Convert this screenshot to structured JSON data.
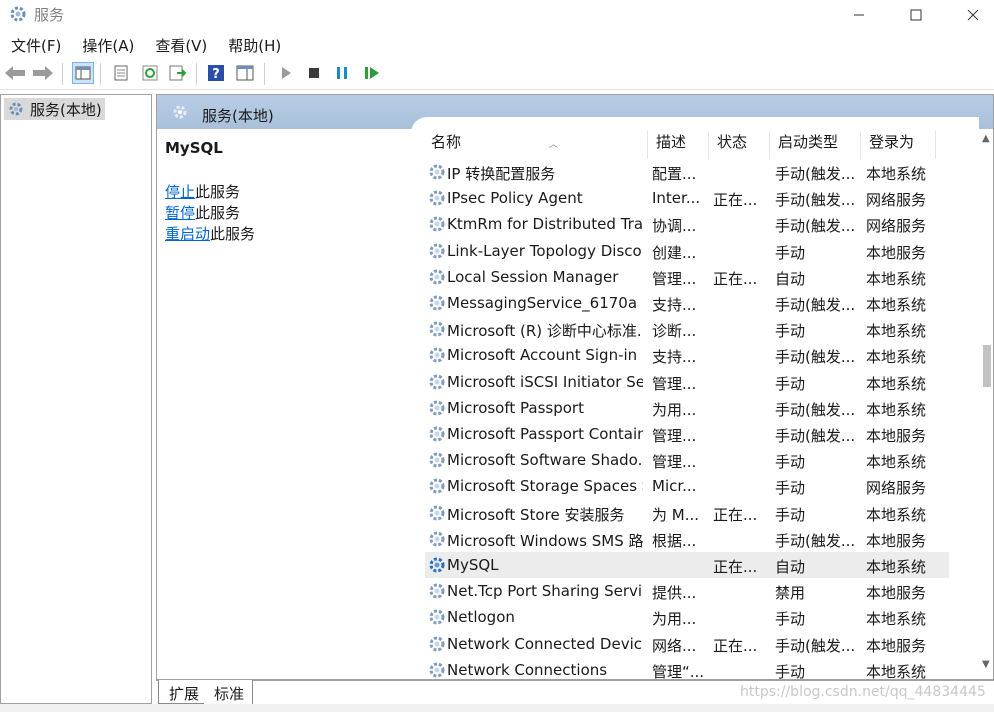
{
  "window": {
    "title": "服务",
    "icon": "gear-icon"
  },
  "menu": [
    "文件(F)",
    "操作(A)",
    "查看(V)",
    "帮助(H)"
  ],
  "tree": {
    "root_label": "服务(本地)"
  },
  "header": {
    "title": "服务(本地)"
  },
  "detail": {
    "service_name": "MySQL",
    "actions": [
      {
        "link": "停止",
        "suffix": "此服务"
      },
      {
        "link": "暂停",
        "suffix": "此服务"
      },
      {
        "link": "重启动",
        "suffix": "此服务"
      }
    ]
  },
  "columns": {
    "name": "名称",
    "desc": "描述",
    "status": "状态",
    "startup": "启动类型",
    "logon": "登录为"
  },
  "rows": [
    {
      "name": "IP 转换配置服务",
      "desc": "配置...",
      "status": "",
      "startup": "手动(触发...",
      "logon": "本地系统"
    },
    {
      "name": "IPsec Policy Agent",
      "desc": "Inter...",
      "status": "正在...",
      "startup": "手动(触发...",
      "logon": "网络服务"
    },
    {
      "name": "KtmRm for Distributed Tra...",
      "desc": "协调...",
      "status": "",
      "startup": "手动(触发...",
      "logon": "网络服务"
    },
    {
      "name": "Link-Layer Topology Disco...",
      "desc": "创建...",
      "status": "",
      "startup": "手动",
      "logon": "本地服务"
    },
    {
      "name": "Local Session Manager",
      "desc": "管理...",
      "status": "正在...",
      "startup": "自动",
      "logon": "本地系统"
    },
    {
      "name": "MessagingService_6170a",
      "desc": "支持...",
      "status": "",
      "startup": "手动(触发...",
      "logon": "本地系统"
    },
    {
      "name": "Microsoft (R) 诊断中心标准...",
      "desc": "诊断...",
      "status": "",
      "startup": "手动",
      "logon": "本地系统"
    },
    {
      "name": "Microsoft Account Sign-in ...",
      "desc": "支持...",
      "status": "",
      "startup": "手动(触发...",
      "logon": "本地系统"
    },
    {
      "name": "Microsoft iSCSI Initiator Ser...",
      "desc": "管理...",
      "status": "",
      "startup": "手动",
      "logon": "本地系统"
    },
    {
      "name": "Microsoft Passport",
      "desc": "为用...",
      "status": "",
      "startup": "手动(触发...",
      "logon": "本地系统"
    },
    {
      "name": "Microsoft Passport Container",
      "desc": "管理...",
      "status": "",
      "startup": "手动(触发...",
      "logon": "本地服务"
    },
    {
      "name": "Microsoft Software Shado...",
      "desc": "管理...",
      "status": "",
      "startup": "手动",
      "logon": "本地系统"
    },
    {
      "name": "Microsoft Storage Spaces S...",
      "desc": "Micr...",
      "status": "",
      "startup": "手动",
      "logon": "网络服务"
    },
    {
      "name": "Microsoft Store 安装服务",
      "desc": "为 M...",
      "status": "正在...",
      "startup": "手动",
      "logon": "本地系统"
    },
    {
      "name": "Microsoft Windows SMS 路...",
      "desc": "根据...",
      "status": "",
      "startup": "手动(触发...",
      "logon": "本地服务"
    },
    {
      "name": "MySQL",
      "desc": "",
      "status": "正在...",
      "startup": "自动",
      "logon": "本地系统",
      "selected": true
    },
    {
      "name": "Net.Tcp Port Sharing Service",
      "desc": "提供...",
      "status": "",
      "startup": "禁用",
      "logon": "本地服务"
    },
    {
      "name": "Netlogon",
      "desc": "为用...",
      "status": "",
      "startup": "手动",
      "logon": "本地系统"
    },
    {
      "name": "Network Connected Devic...",
      "desc": "网络...",
      "status": "正在...",
      "startup": "手动(触发...",
      "logon": "本地服务"
    },
    {
      "name": "Network Connections",
      "desc": "管理“...",
      "status": "",
      "startup": "手动",
      "logon": "本地系统"
    }
  ],
  "tabs": [
    "扩展",
    "标准"
  ],
  "watermark": "https://blog.csdn.net/qq_44834445"
}
